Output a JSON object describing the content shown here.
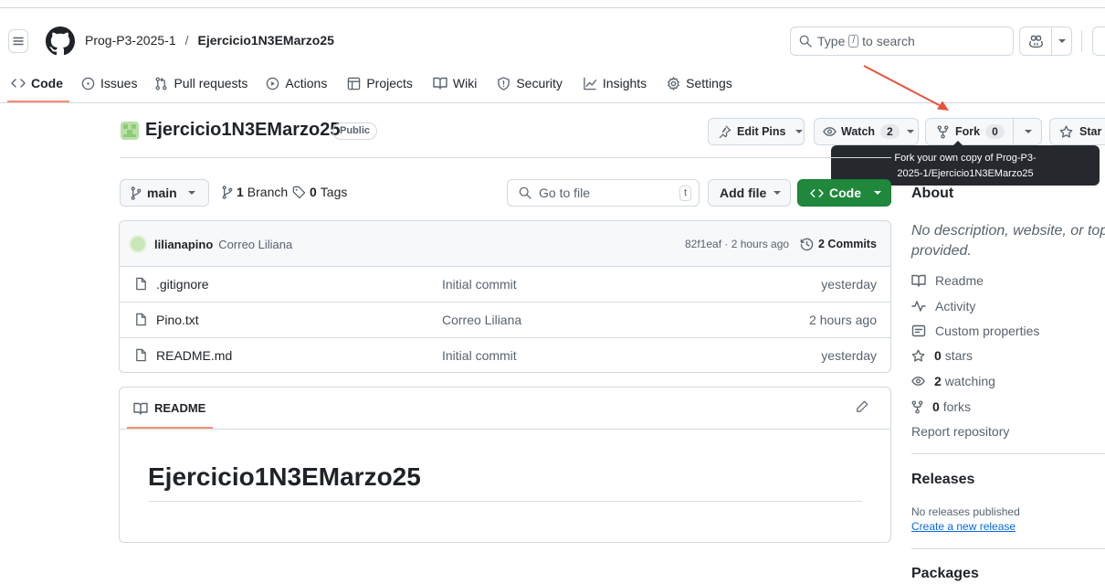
{
  "header": {
    "owner": "Prog-P3-2025-1",
    "separator": "/",
    "repo": "Ejercicio1N3EMarzo25",
    "search": {
      "prefix": "Type",
      "key": "/",
      "suffix": "to search"
    }
  },
  "tabs": [
    {
      "label": "Code"
    },
    {
      "label": "Issues"
    },
    {
      "label": "Pull requests"
    },
    {
      "label": "Actions"
    },
    {
      "label": "Projects"
    },
    {
      "label": "Wiki"
    },
    {
      "label": "Security"
    },
    {
      "label": "Insights"
    },
    {
      "label": "Settings"
    }
  ],
  "repo_header": {
    "name": "Ejercicio1N3EMarzo25",
    "visibility": "Public",
    "edit_pins": "Edit Pins",
    "watch": {
      "label": "Watch",
      "count": "2"
    },
    "fork": {
      "label": "Fork",
      "count": "0"
    },
    "star": {
      "label": "Star"
    }
  },
  "tooltip": {
    "line1": "Fork your own copy of Prog-P3-",
    "line2": "2025-1/Ejercicio1N3EMarzo25"
  },
  "toolbar": {
    "branch": "main",
    "branch_count": "1",
    "branch_label": "Branch",
    "tag_count": "0",
    "tag_label": "Tags",
    "go_to_file": "Go to file",
    "go_to_file_key": "t",
    "add_file": "Add file",
    "code": "Code"
  },
  "commit": {
    "author": "lilianapino",
    "message": "Correo Liliana",
    "meta": "82f1eaf · 2 hours ago",
    "commits": "2 Commits"
  },
  "files": [
    {
      "name": ".gitignore",
      "message": "Initial commit",
      "time": "yesterday"
    },
    {
      "name": "Pino.txt",
      "message": "Correo Liliana",
      "time": "2 hours ago"
    },
    {
      "name": "README.md",
      "message": "Initial commit",
      "time": "yesterday"
    }
  ],
  "readme": {
    "tab": "README",
    "heading": "Ejercicio1N3EMarzo25"
  },
  "about": {
    "title": "About",
    "description_line1": "No description, website, or top",
    "description_line2": "provided.",
    "readme": "Readme",
    "activity": "Activity",
    "custom_properties": "Custom properties",
    "stars_count": "0",
    "stars_label": "stars",
    "watching_count": "2",
    "watching_label": "watching",
    "forks_count": "0",
    "forks_label": "forks",
    "report": "Report repository"
  },
  "releases": {
    "title": "Releases",
    "none": "No releases published",
    "create": "Create a new release"
  },
  "packages": {
    "title": "Packages"
  },
  "colors": {
    "accent": "#fd8c73",
    "primary_green": "#1f883d",
    "link": "#0969da",
    "arrow": "#e5533d",
    "tooltip_bg": "#25292e"
  }
}
